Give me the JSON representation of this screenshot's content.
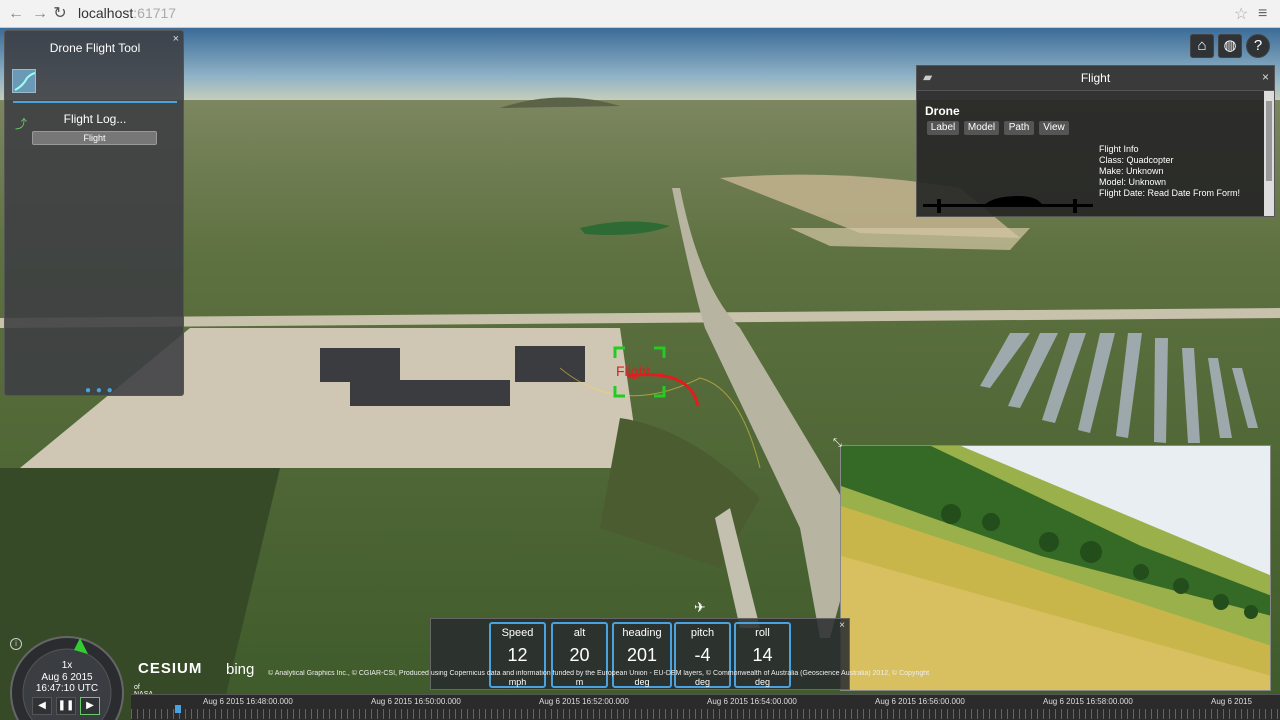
{
  "browser": {
    "url_host": "localhost",
    "url_port": ":61717",
    "back_icon": "back-arrow-icon",
    "forward_icon": "forward-arrow-icon",
    "reload_icon": "reload-icon"
  },
  "tool_panel": {
    "title": "Drone Flight Tool",
    "close": "×",
    "log_label": "Flight Log...",
    "flight_button": "Flight"
  },
  "top_icons": [
    "home-icon",
    "globe-icon",
    "help-icon"
  ],
  "info_box": {
    "title": "Flight",
    "close": "×",
    "entity_name": "Drone",
    "tabs": [
      "Label",
      "Model",
      "Path",
      "View"
    ],
    "lines": [
      "Flight Info",
      "Class: Quadcopter",
      "Make: Unknown",
      "Model: Unknown",
      "Flight Date: Read Date From Form!"
    ]
  },
  "marker_label": "Flight",
  "hud": {
    "close": "×",
    "gauges": [
      {
        "label": "Speed",
        "value": "12",
        "unit": "mph"
      },
      {
        "label": "alt",
        "value": "20",
        "unit": "m"
      },
      {
        "label": "heading",
        "value": "201",
        "unit": "deg"
      },
      {
        "label": "pitch",
        "value": "-4",
        "unit": "deg"
      },
      {
        "label": "roll",
        "value": "14",
        "unit": "deg"
      }
    ]
  },
  "animation": {
    "speed": "1x",
    "date": "Aug 6 2015",
    "time": "16:47:10 UTC"
  },
  "credits": {
    "cesium": "CESIUM",
    "bing": "bing",
    "attribution": "© Analytical Graphics Inc., © CGIAR-CSI, Produced using Copernicus data and information funded by the European Union - EU-DEM layers, © Commonwealth of Australia (Geoscience Australia) 2012, © Copyright",
    "nasa": "of NASA"
  },
  "timeline": {
    "labels": [
      "Aug 6 2015 16:48:00.000",
      "Aug 6 2015 16:50:00.000",
      "Aug 6 2015 16:52:00.000",
      "Aug 6 2015 16:54:00.000",
      "Aug 6 2015 16:56:00.000",
      "Aug 6 2015 16:58:00.000",
      "Aug 6 2015"
    ]
  },
  "colors": {
    "accent": "#4aa3df",
    "marker": "#22cc22",
    "path": "#e01e1e"
  }
}
